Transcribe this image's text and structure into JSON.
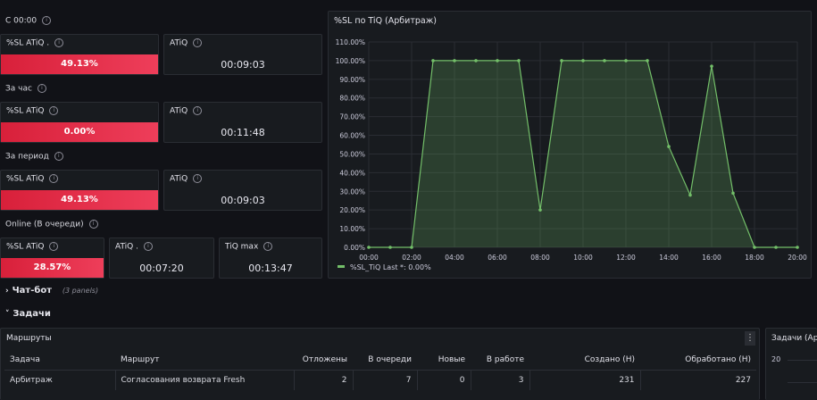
{
  "sections": {
    "since_midnight": "С 00:00",
    "per_hour": "За час",
    "per_period": "За период",
    "online": "Online (В очереди)"
  },
  "stats": {
    "s1_sl_title": "%SL ATiQ .",
    "s1_sl_value": "49.13%",
    "s1_atiq_title": "ATiQ",
    "s1_atiq_value": "00:09:03",
    "s2_sl_title": "%SL ATiQ",
    "s2_sl_value": "0.00%",
    "s2_atiq_title": "ATiQ",
    "s2_atiq_value": "00:11:48",
    "s3_sl_title": "%SL ATiQ",
    "s3_sl_value": "49.13%",
    "s3_atiq_title": "ATiQ",
    "s3_atiq_value": "00:09:03",
    "s4_sl_title": "%SL ATiQ",
    "s4_sl_value": "28.57%",
    "s4_atiq_title": "ATiQ .",
    "s4_atiq_value": "00:07:20",
    "s4_max_title": "TiQ max",
    "s4_max_value": "00:13:47"
  },
  "rows": {
    "chatbot": "Чат-бот",
    "chatbot_count": "(3 panels)",
    "tasks": "Задачи"
  },
  "routes_panel": {
    "title": "Маршруты",
    "columns": [
      "Задача",
      "Маршрут",
      "Отложены",
      "В очереди",
      "Новые",
      "В работе",
      "Создано (H)",
      "Обработано (H)"
    ],
    "rows": [
      [
        "Арбитраж",
        "Согласования возврата Fresh",
        "2",
        "7",
        "0",
        "3",
        "231",
        "227"
      ]
    ]
  },
  "tasks_panel": {
    "title": "Задачи (Ар",
    "axis_value": "20"
  },
  "chart_data": {
    "type": "area",
    "title": "%SL по TiQ (Арбитраж)",
    "x": [
      "00:00",
      "01:00",
      "02:00",
      "03:00",
      "04:00",
      "05:00",
      "06:00",
      "07:00",
      "08:00",
      "09:00",
      "10:00",
      "11:00",
      "12:00",
      "13:00",
      "14:00",
      "15:00",
      "16:00",
      "17:00",
      "18:00",
      "19:00",
      "20:00"
    ],
    "series": [
      {
        "name": "%SL_TiQ",
        "values": [
          0,
          0,
          0,
          100,
          100,
          100,
          100,
          100,
          20,
          100,
          100,
          100,
          100,
          100,
          54,
          28,
          97,
          29,
          0,
          0,
          0
        ]
      }
    ],
    "x_ticks": [
      "00:00",
      "02:00",
      "04:00",
      "06:00",
      "08:00",
      "10:00",
      "12:00",
      "14:00",
      "16:00",
      "18:00",
      "20:00"
    ],
    "y_ticks": [
      "0.00%",
      "10.00%",
      "20.00%",
      "30.00%",
      "40.00%",
      "50.00%",
      "60.00%",
      "70.00%",
      "80.00%",
      "90.00%",
      "100.00%",
      "110.00%"
    ],
    "ylim": [
      0,
      110
    ],
    "legend_text": "%SL_TiQ  Last *: 0.00%",
    "legend_position": "bottom-left",
    "grid": true,
    "colors": {
      "line": "#73bf69",
      "fill": "#73bf69"
    }
  }
}
